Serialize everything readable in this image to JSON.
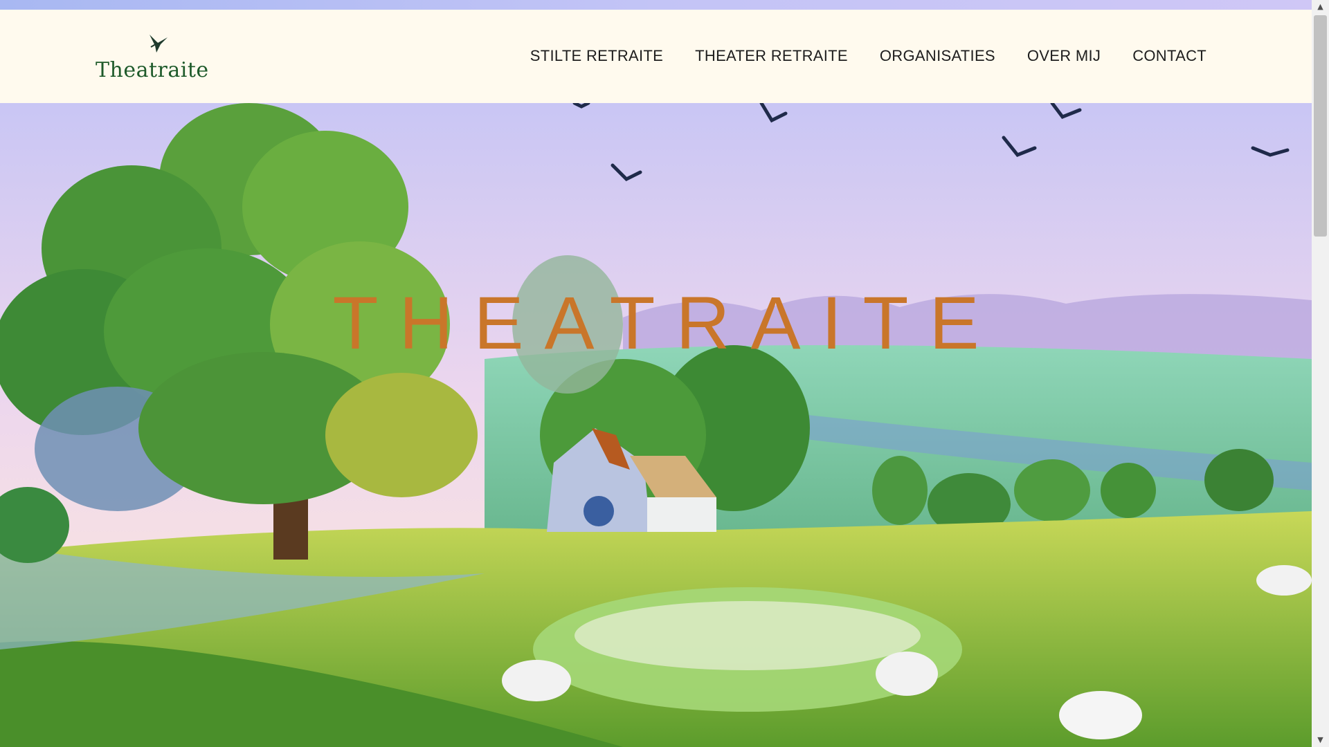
{
  "logo": {
    "text": "Theatraite",
    "icon": "hummingbird-icon"
  },
  "nav": {
    "items": [
      {
        "label": "STILTE RETRAITE"
      },
      {
        "label": "THEATER RETRAITE"
      },
      {
        "label": "ORGANISATIES"
      },
      {
        "label": "OVER MIJ"
      },
      {
        "label": "CONTACT"
      }
    ]
  },
  "hero": {
    "title": "THEATRAITE",
    "title_color": "#c9762a",
    "image": "landscape-illustration"
  },
  "scrollbar": {
    "up": "up-arrow-icon",
    "down": "down-arrow-icon"
  }
}
